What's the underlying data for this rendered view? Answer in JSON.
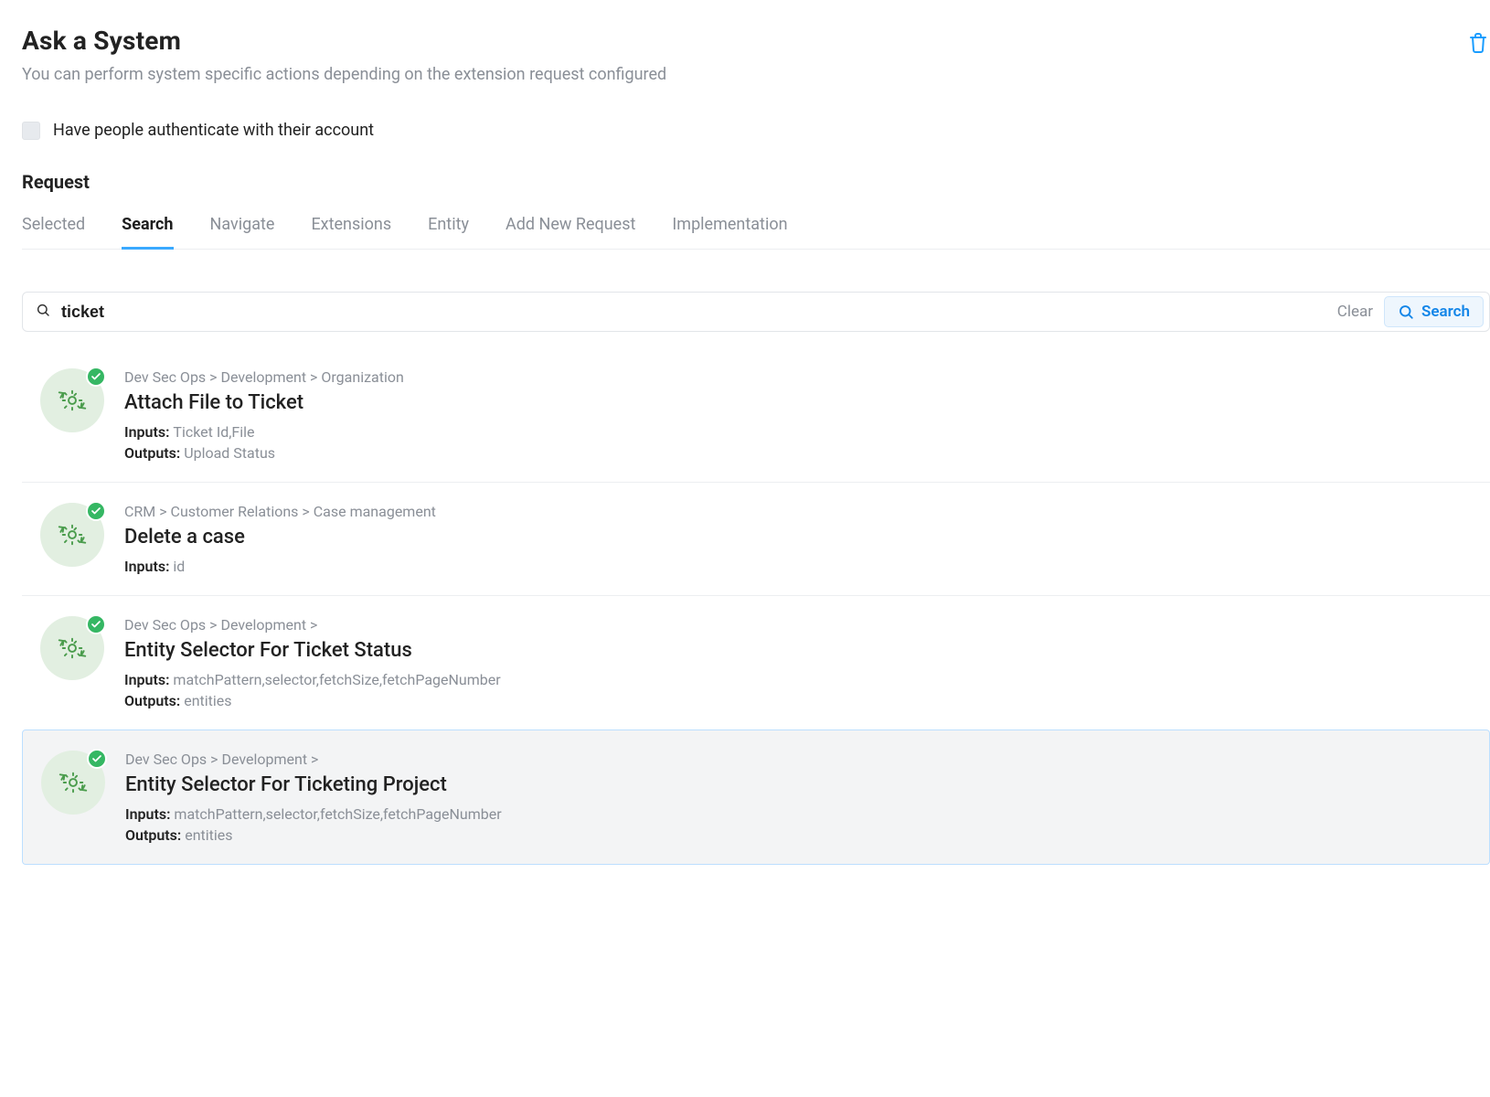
{
  "header": {
    "title": "Ask a System",
    "subtitle": "You can perform system specific actions depending on the extension request configured"
  },
  "auth": {
    "label": "Have people authenticate with their account",
    "checked": false
  },
  "section_label": "Request",
  "tabs": [
    {
      "label": "Selected",
      "active": false
    },
    {
      "label": "Search",
      "active": true
    },
    {
      "label": "Navigate",
      "active": false
    },
    {
      "label": "Extensions",
      "active": false
    },
    {
      "label": "Entity",
      "active": false
    },
    {
      "label": "Add New Request",
      "active": false
    },
    {
      "label": "Implementation",
      "active": false
    }
  ],
  "search": {
    "value": "ticket",
    "clear_label": "Clear",
    "button_label": "Search"
  },
  "io_labels": {
    "inputs": "Inputs:",
    "outputs": "Outputs:"
  },
  "results": [
    {
      "breadcrumb": "Dev Sec Ops > Development > Organization",
      "title": "Attach File to Ticket",
      "inputs": "Ticket Id,File",
      "outputs": "Upload Status",
      "selected": false
    },
    {
      "breadcrumb": "CRM > Customer Relations > Case management",
      "title": "Delete a case",
      "inputs": "id",
      "outputs": null,
      "selected": false
    },
    {
      "breadcrumb": "Dev Sec Ops > Development >",
      "title": "Entity Selector For Ticket Status",
      "inputs": "matchPattern,selector,fetchSize,fetchPageNumber",
      "outputs": "entities",
      "selected": false
    },
    {
      "breadcrumb": "Dev Sec Ops > Development >",
      "title": "Entity Selector For Ticketing Project",
      "inputs": "matchPattern,selector,fetchSize,fetchPageNumber",
      "outputs": "entities",
      "selected": true
    }
  ]
}
